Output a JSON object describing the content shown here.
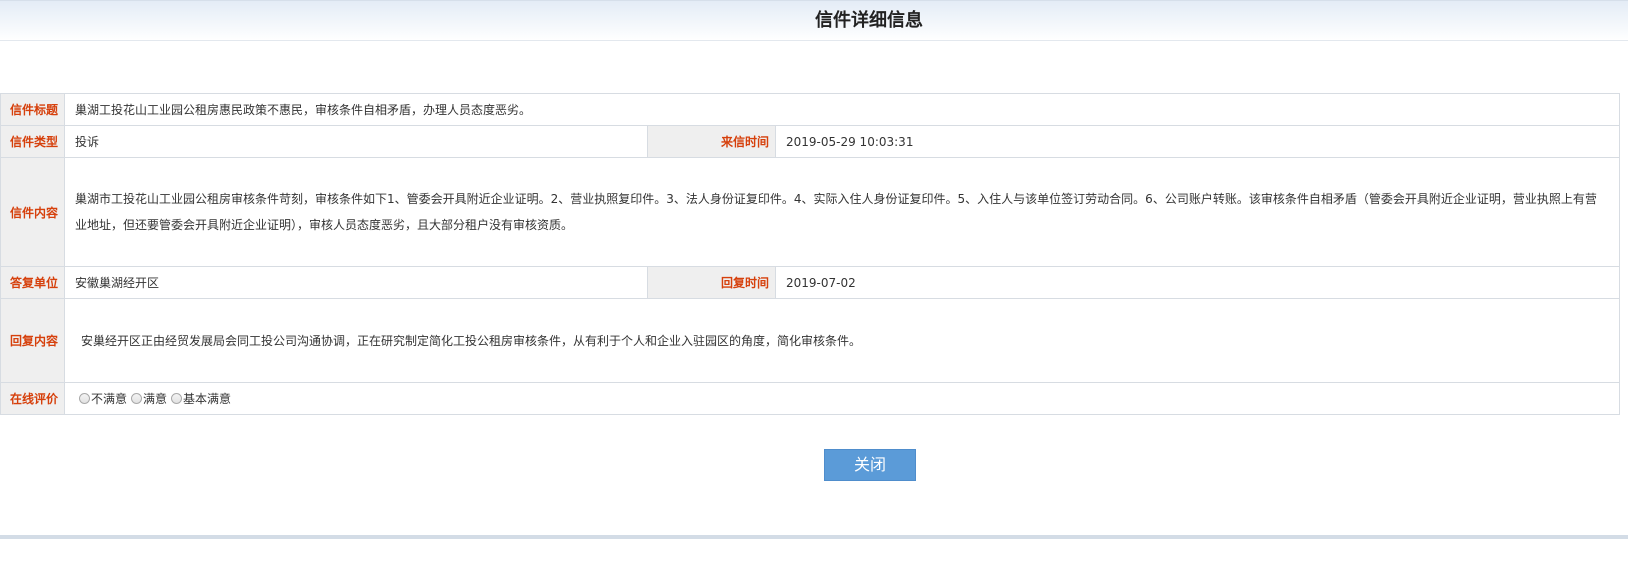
{
  "header": {
    "title": "信件详细信息"
  },
  "letter": {
    "title_label": "信件标题",
    "title_value": "巢湖工投花山工业园公租房惠民政策不惠民，审核条件自相矛盾，办理人员态度恶劣。",
    "type_label": "信件类型",
    "type_value": "投诉",
    "date_label": "来信时间",
    "date_value": "2019-05-29 10:03:31",
    "content_label": "信件内容",
    "content_value": " 巢湖市工投花山工业园公租房审核条件苛刻，审核条件如下1、管委会开具附近企业证明。2、营业执照复印件。3、法人身份证复印件。4、实际入住人身份证复印件。5、入住人与该单位签订劳动合同。6、公司账户转账。该审核条件自相矛盾（管委会开具附近企业证明，营业执照上有营业地址，但还要管委会开具附近企业证明），审核人员态度恶劣，且大部分租户没有审核资质。",
    "unit_label": "答复单位",
    "unit_value": "安徽巢湖经开区",
    "reply_date_label": "回复时间",
    "reply_date_value": "2019-07-02",
    "reply_label": "回复内容",
    "reply_value": "安巢经开区正由经贸发展局会同工投公司沟通协调，正在研究制定简化工投公租房审核条件，从有利于个人和企业入驻园区的角度，简化审核条件。",
    "rating_label": "在线评价",
    "rating_options": [
      "不满意",
      "满意",
      "基本满意"
    ]
  },
  "actions": {
    "close_label": "关闭"
  },
  "colors": {
    "label_text": "#d6400c",
    "label_bg": "#efefef",
    "button_bg": "#5b9bd8",
    "border": "#d7dce2"
  }
}
